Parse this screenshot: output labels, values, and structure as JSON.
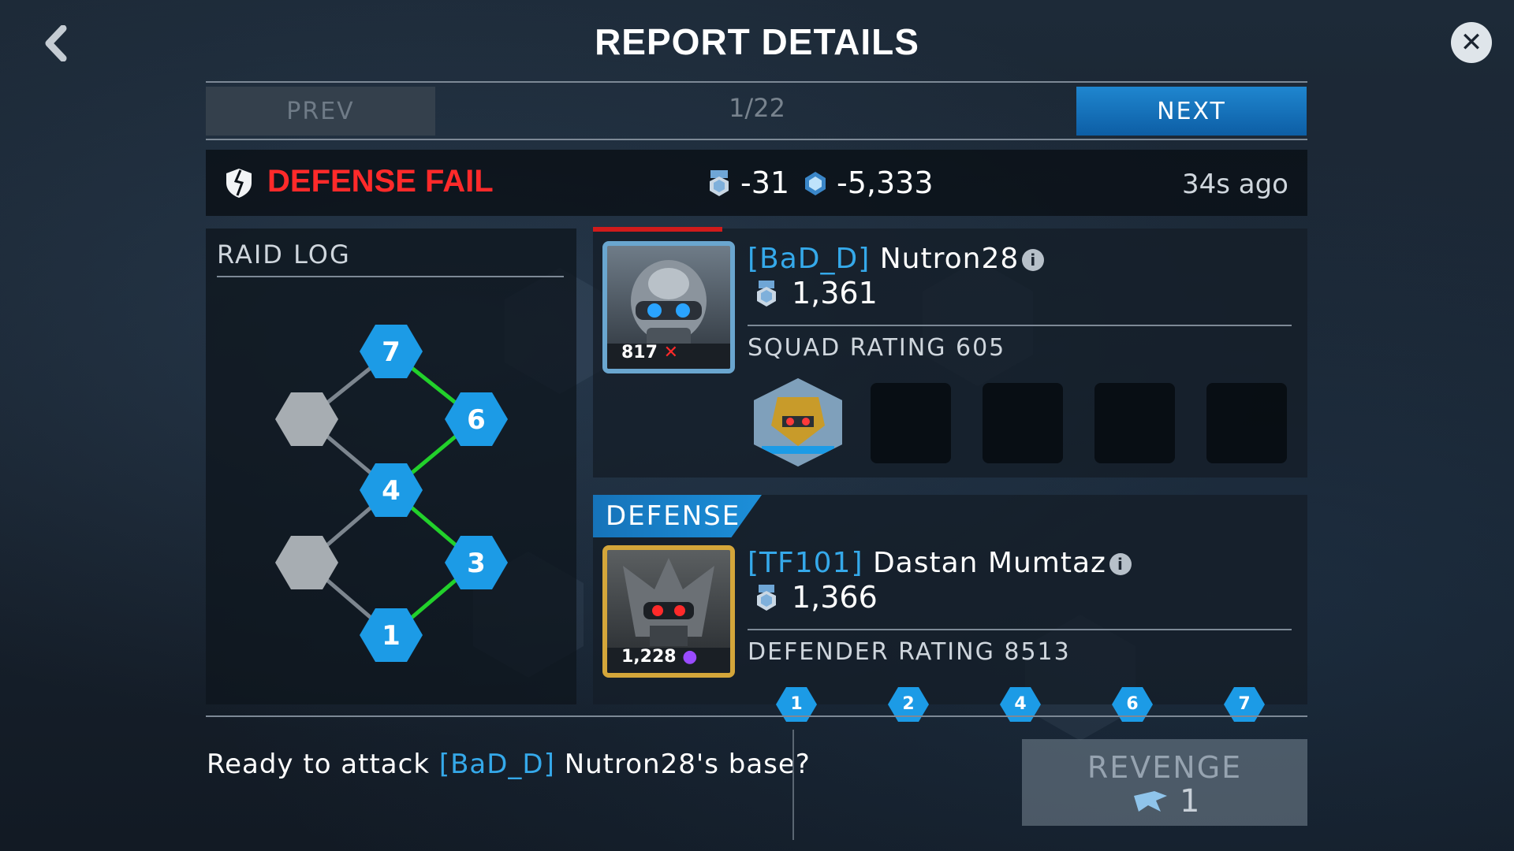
{
  "header": {
    "title": "REPORT DETAILS",
    "back_icon": "chevron-left-icon",
    "close_icon": "close-icon"
  },
  "pager": {
    "prev_label": "PREV",
    "page_indicator": "1/22",
    "next_label": "NEXT"
  },
  "result": {
    "label": "DEFENSE FAIL",
    "medal_change": "-31",
    "resource_change": "-5,333",
    "time_ago": "34s ago",
    "color": "#ff2a2a"
  },
  "raid_log": {
    "title": "RAID LOG",
    "nodes": [
      {
        "label": "7",
        "state": "visited"
      },
      {
        "label": "6",
        "state": "visited"
      },
      {
        "label": "4",
        "state": "visited"
      },
      {
        "label": "3",
        "state": "visited"
      },
      {
        "label": "1",
        "state": "visited"
      },
      {
        "label": "",
        "state": "unvisited"
      },
      {
        "label": "",
        "state": "unvisited"
      }
    ]
  },
  "attacker": {
    "tag": "[BaD_D]",
    "name": "Nutron28",
    "medals": "1,361",
    "portrait_level": "817",
    "squad_rating_label": "SQUAD RATING 605"
  },
  "defender": {
    "section_label": "DEFENSE",
    "tag": "[TF101]",
    "name": "Dastan Mumtaz",
    "medals": "1,366",
    "portrait_level": "1,228",
    "defender_rating_label": "DEFENDER RATING 8513",
    "node_labels": [
      "1",
      "2",
      "4",
      "6",
      "7"
    ]
  },
  "footer": {
    "prompt_pre": "Ready to attack",
    "prompt_tag": "[BaD_D]",
    "prompt_post": "Nutron28's base?",
    "revenge_label": "REVENGE",
    "revenge_count": "1"
  },
  "colors": {
    "accent_blue": "#1c9be6",
    "path_green": "#22d12b",
    "tag_blue": "#35a9ea"
  }
}
